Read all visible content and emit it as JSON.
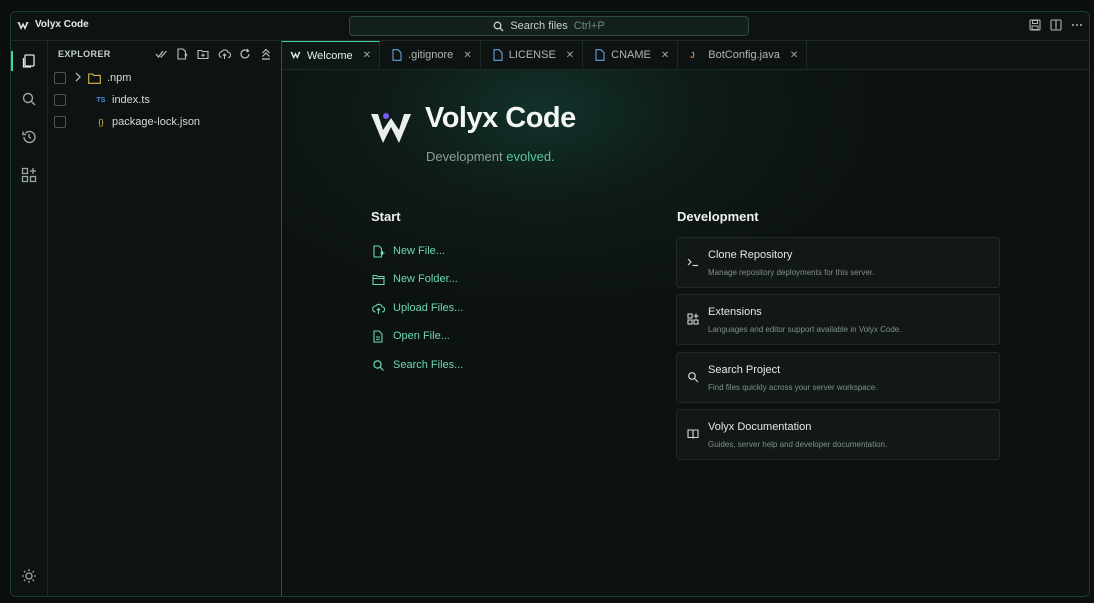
{
  "window": {
    "title": "Volyx Code"
  },
  "search": {
    "label": "Search files",
    "shortcut": "Ctrl+P"
  },
  "top_actions": [
    "save-icon",
    "split-editor-icon",
    "more-icon"
  ],
  "activity_bar": [
    "files-icon",
    "search-icon",
    "history-icon",
    "extensions-icon"
  ],
  "explorer": {
    "title": "EXPLORER",
    "actions": [
      "check-all-icon",
      "new-file-icon",
      "new-folder-icon",
      "upload-icon",
      "refresh-icon",
      "collapse-icon"
    ],
    "items": [
      {
        "name": ".npm",
        "type": "folder"
      },
      {
        "name": "index.ts",
        "type": "ts",
        "badge": "TS"
      },
      {
        "name": "package-lock.json",
        "type": "json",
        "badge": "{}"
      }
    ]
  },
  "tabs": [
    {
      "label": "Welcome",
      "icon": "volyx-logo-icon",
      "active": true
    },
    {
      "label": ".gitignore",
      "icon": "file-icon"
    },
    {
      "label": "LICENSE",
      "icon": "file-icon"
    },
    {
      "label": "CNAME",
      "icon": "file-icon"
    },
    {
      "label": "BotConfig.java",
      "icon": "java-icon",
      "badge": "J"
    }
  ],
  "welcome": {
    "brand": "Volyx Code",
    "tagline_prefix": "Development",
    "tagline_accent": "evolved.",
    "start": {
      "title": "Start",
      "links": [
        "New File...",
        "New Folder...",
        "Upload Files...",
        "Open File...",
        "Search Files..."
      ]
    },
    "development": {
      "title": "Development",
      "cards": [
        {
          "title": "Clone Repository",
          "desc": "Manage repository deployments for this server."
        },
        {
          "title": "Extensions",
          "desc": "Languages and editor support available in Volyx Code."
        },
        {
          "title": "Search Project",
          "desc": "Find files quickly across your server workspace."
        },
        {
          "title": "Volyx Documentation",
          "desc": "Guides, server help and developer documentation."
        }
      ]
    }
  },
  "colors": {
    "accent": "#3fd6a0",
    "link": "#6fd7ae",
    "background": "#0b100f"
  }
}
